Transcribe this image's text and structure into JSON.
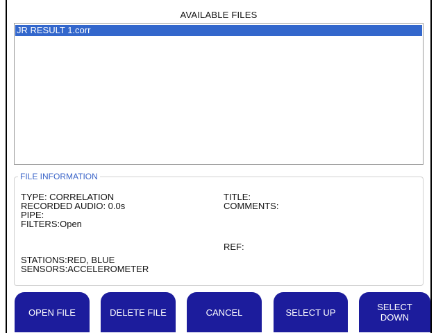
{
  "list": {
    "title": "AVAILABLE FILES",
    "items": [
      {
        "name": "JR RESULT 1.corr",
        "selected": true
      }
    ]
  },
  "info": {
    "legend": "FILE INFORMATION",
    "type": "TYPE: CORRELATION",
    "recorded_audio": "RECORDED AUDIO: 0.0s",
    "pipe": "PIPE:",
    "filters": "FILTERS:Open",
    "stations": "STATIONS:RED, BLUE",
    "sensors": "SENSORS:ACCELEROMETER",
    "title": "TITLE:",
    "comments": "COMMENTS:",
    "ref": "REF:"
  },
  "buttons": {
    "open": "OPEN FILE",
    "delete": "DELETE FILE",
    "cancel": "CANCEL",
    "select_up": "SELECT UP",
    "select_down_line1": "SELECT",
    "select_down_line2": "DOWN"
  },
  "colors": {
    "selection": "#3367cc",
    "button": "#1c1c9c",
    "legend": "#3a64c8"
  }
}
